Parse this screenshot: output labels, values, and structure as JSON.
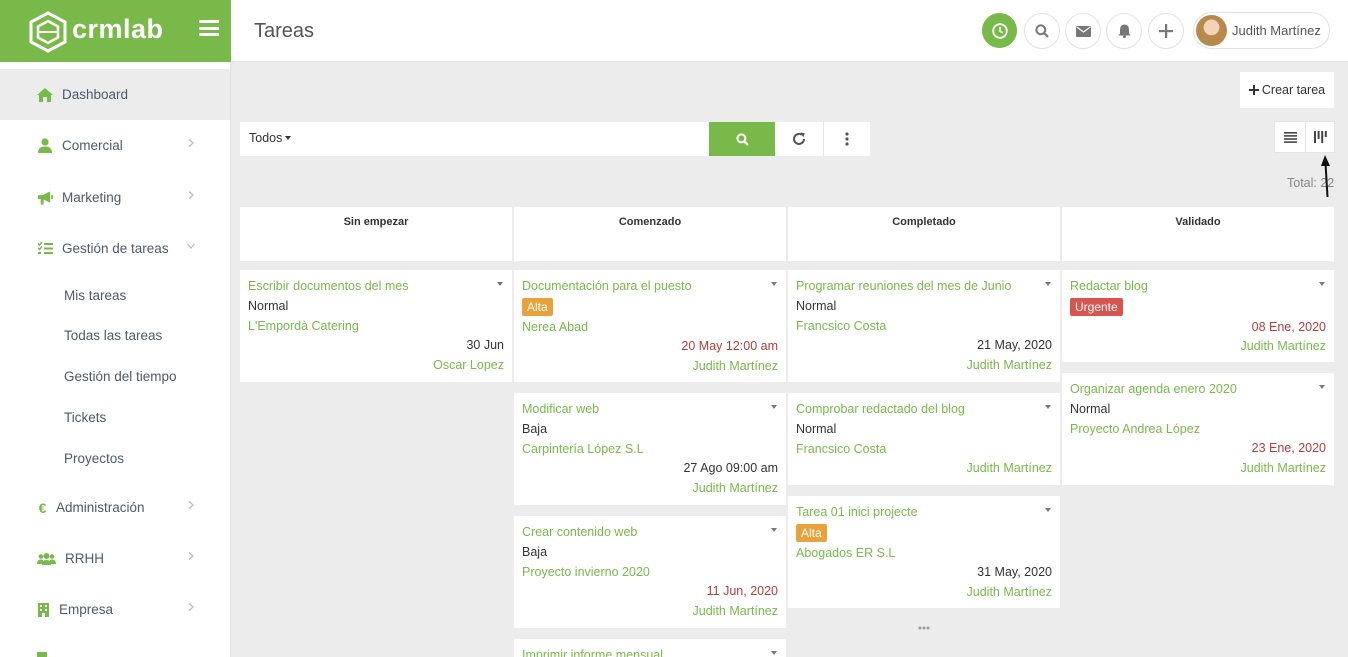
{
  "app": {
    "logo_text": "crmlab",
    "page_title": "Tareas",
    "user_name": "Judith Martínez",
    "accent": "#78b94a"
  },
  "sidebar": {
    "items": [
      {
        "label": "Dashboard",
        "icon": "home-icon"
      },
      {
        "label": "Comercial",
        "icon": "user-icon"
      },
      {
        "label": "Marketing",
        "icon": "megaphone-icon"
      },
      {
        "label": "Gestión de tareas",
        "icon": "tasks-icon"
      },
      {
        "label": "Administración",
        "icon": "euro-icon"
      },
      {
        "label": "RRHH",
        "icon": "users-icon"
      },
      {
        "label": "Empresa",
        "icon": "building-icon"
      }
    ],
    "sub_items": [
      "Mis tareas",
      "Todas las tareas",
      "Gestión del tiempo",
      "Tickets",
      "Proyectos"
    ]
  },
  "toolbar": {
    "create_label": "Crear tarea",
    "filter_label": "Todos",
    "search_placeholder": "",
    "total_label": "Total: 22"
  },
  "board": {
    "columns": [
      {
        "name": "Sin empezar",
        "cards": [
          {
            "title": "Escribir documentos del mes",
            "priority": "Normal",
            "client": "L'Empordà Catering",
            "date": "30 Jun",
            "owner": "Oscar Lopez"
          }
        ]
      },
      {
        "name": "Comenzado",
        "cards": [
          {
            "title": "Documentación para el puesto",
            "badge": "Alta",
            "client": "Nerea Abad",
            "date": "20 May 12:00 am",
            "date_overdue": true,
            "owner": "Judith Martínez"
          },
          {
            "title": "Modificar web",
            "priority": "Baja",
            "client": "Carpintería López S.L",
            "date": "27 Ago 09:00 am",
            "owner": "Judith Martínez"
          },
          {
            "title": "Crear contenido web",
            "priority": "Baja",
            "client": "Proyecto invierno 2020",
            "date": "11 Jun, 2020",
            "date_overdue": true,
            "owner": "Judith Martínez"
          },
          {
            "title": "Imprimir informe mensual"
          }
        ]
      },
      {
        "name": "Completado",
        "cards": [
          {
            "title": "Programar reuniones del mes de Junio",
            "priority": "Normal",
            "client": "Francsico Costa",
            "date": "21 May, 2020",
            "owner": "Judith Martínez"
          },
          {
            "title": "Comprobar redactado del blog",
            "priority": "Normal",
            "client": "Francsico Costa",
            "owner": "Judith Martínez"
          },
          {
            "title": "Tarea 01 inici projecte",
            "badge": "Alta",
            "client": "Abogados ER S.L",
            "date": "31 May, 2020",
            "owner": "Judith Martínez"
          }
        ]
      },
      {
        "name": "Validado",
        "cards": [
          {
            "title": "Redactar blog",
            "badge": "Urgente",
            "date": "08 Ene, 2020",
            "date_overdue": true,
            "owner": "Judith Martínez"
          },
          {
            "title": "Organizar agenda enero 2020",
            "priority": "Normal",
            "client": "Proyecto Andrea López",
            "date": "23 Ene, 2020",
            "date_overdue": true,
            "owner": "Judith Martínez"
          }
        ]
      }
    ]
  }
}
